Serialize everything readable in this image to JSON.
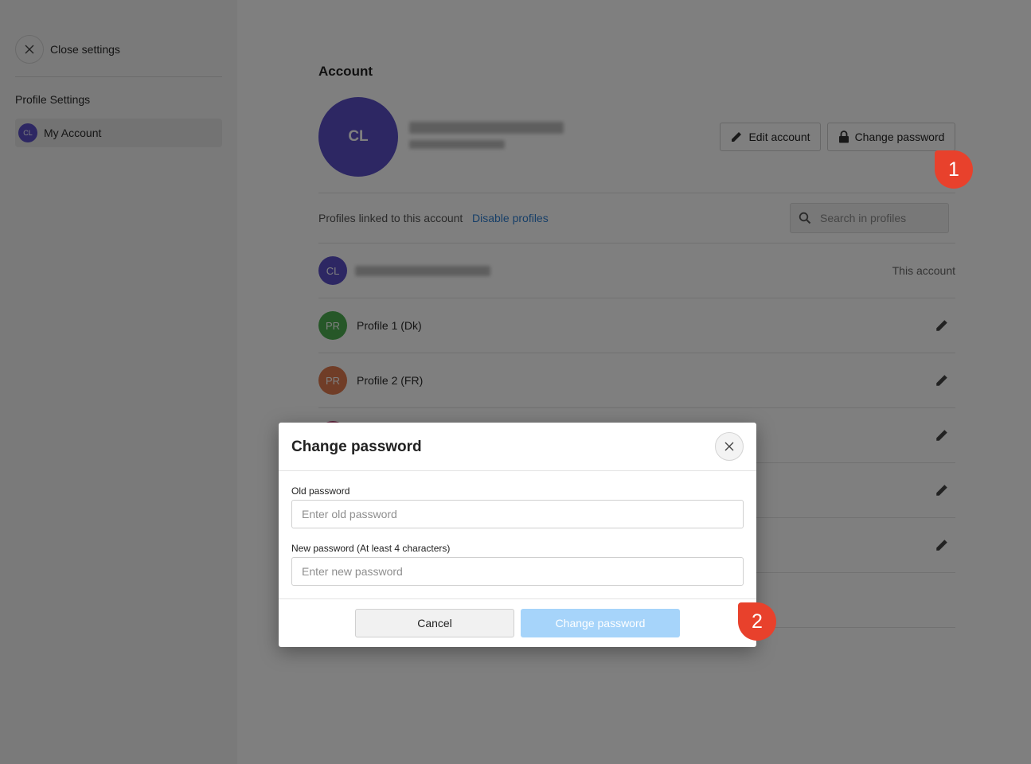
{
  "sidebar": {
    "close_label": "Close settings",
    "heading": "Profile Settings",
    "items": [
      {
        "avatar": "CL",
        "label": "My Account",
        "active": true
      }
    ]
  },
  "account": {
    "title": "Account",
    "avatar_initials": "CL",
    "edit_button": "Edit account",
    "change_password_button": "Change password",
    "linked_label": "Profiles linked to this account",
    "disable_link": "Disable profiles",
    "search_placeholder": "Search in profiles",
    "profiles": [
      {
        "initials": "CL",
        "name": "",
        "tag": "This account",
        "color": "#5a4fc7"
      },
      {
        "initials": "PR",
        "name": "Profile 1 (Dk)",
        "color": "#4caf50"
      },
      {
        "initials": "PR",
        "name": "Profile 2 (FR)",
        "color": "#e07a4f"
      }
    ]
  },
  "modal": {
    "title": "Change password",
    "old_label": "Old password",
    "old_placeholder": "Enter old password",
    "new_label": "New password (At least 4 characters)",
    "new_placeholder": "Enter new password",
    "cancel": "Cancel",
    "submit": "Change password"
  },
  "markers": [
    "1",
    "2"
  ],
  "colors": {
    "accent": "#5a4fc7",
    "link": "#2f7fd1",
    "primary_disabled": "#a6d4fa",
    "marker": "#e8412c"
  }
}
